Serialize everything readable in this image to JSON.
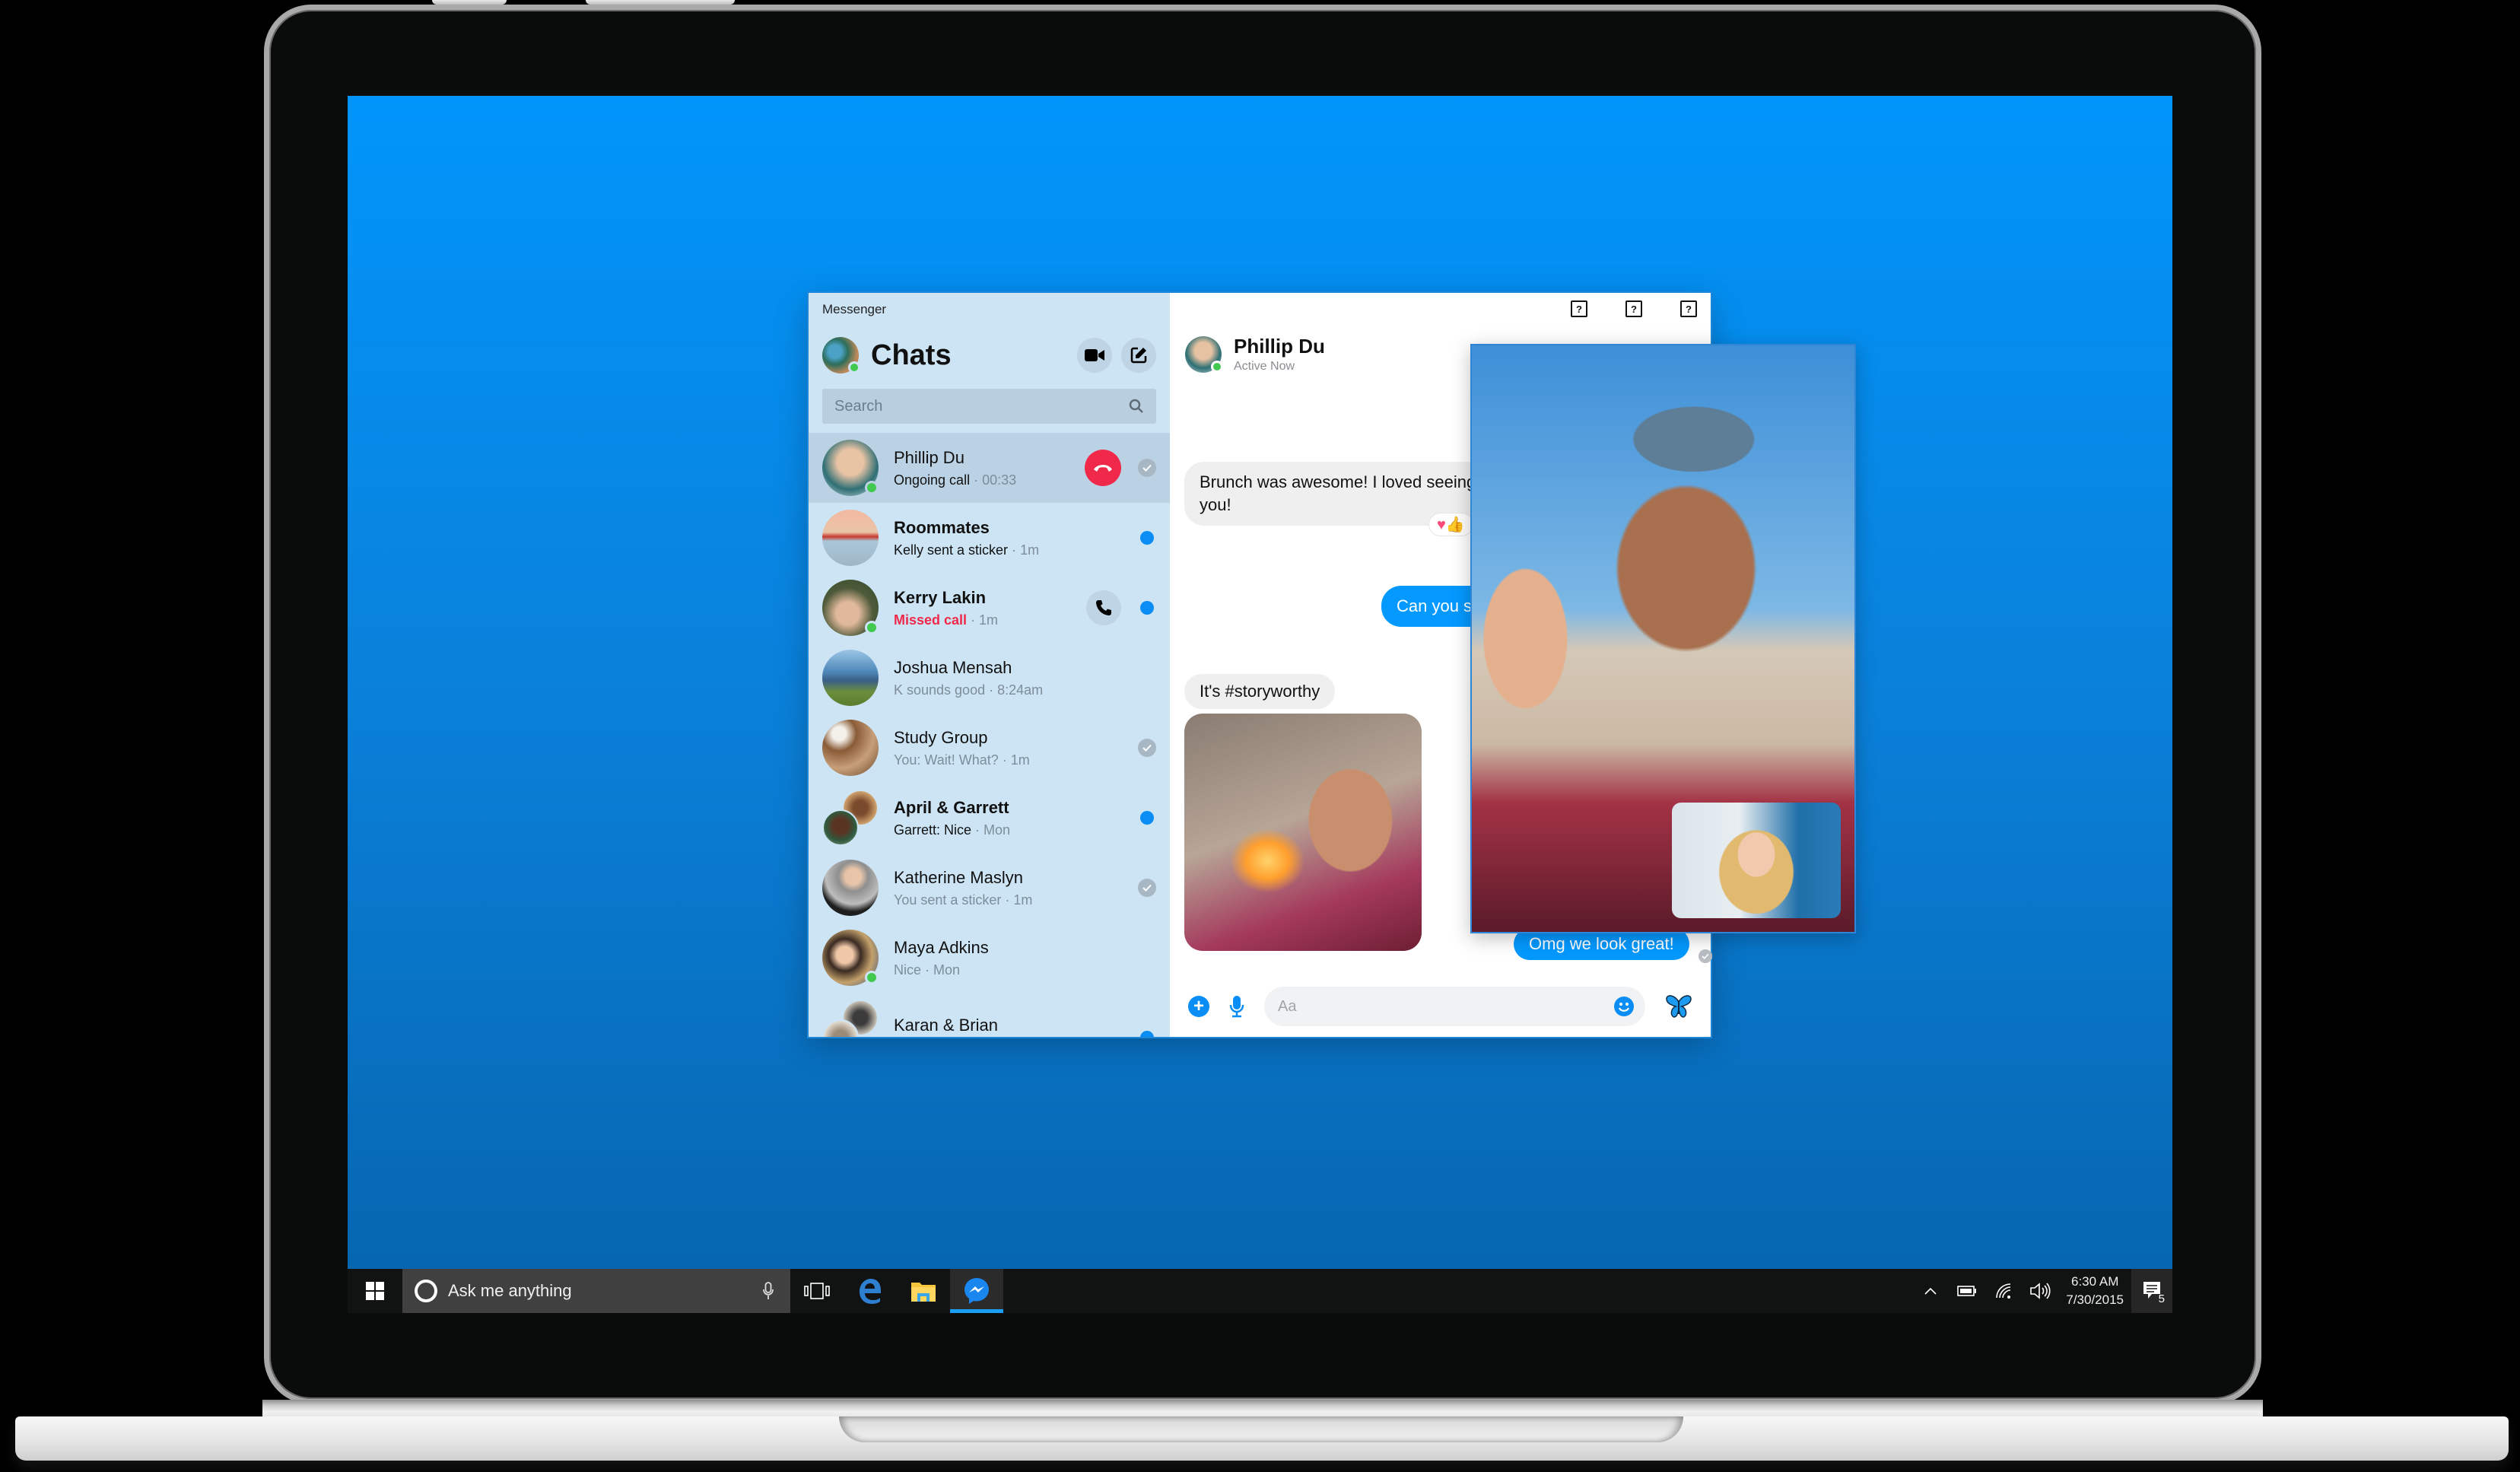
{
  "taskbar": {
    "search_placeholder": "Ask me anything",
    "pinned_apps": [
      "task-view",
      "edge",
      "file-explorer",
      "messenger"
    ],
    "active_app": "messenger",
    "clock_time": "6:30 AM",
    "clock_date": "7/30/2015",
    "notification_count": "5"
  },
  "app": {
    "window_title": "Messenger",
    "accent_color": "#0499ff",
    "sidebar": {
      "title": "Chats",
      "search_placeholder": "Search",
      "chats": [
        {
          "name": "Phillip Du",
          "message": "Ongoing call",
          "time": "00:33",
          "name_bold": false,
          "msg_style": "dark",
          "online": true,
          "action": "end-call",
          "status": "read"
        },
        {
          "name": "Roommates",
          "message": "Kelly sent a sticker",
          "time": "1m",
          "name_bold": true,
          "msg_style": "dark",
          "online": false,
          "action": "",
          "status": "unread"
        },
        {
          "name": "Kerry Lakin",
          "message": "Missed call",
          "time": "1m",
          "name_bold": true,
          "msg_style": "missed",
          "online": true,
          "action": "call",
          "status": "unread"
        },
        {
          "name": "Joshua Mensah",
          "message": "K sounds good",
          "time": "8:24am",
          "name_bold": false,
          "msg_style": "normal",
          "online": false,
          "action": "",
          "status": ""
        },
        {
          "name": "Study Group",
          "message": "You: Wait! What?",
          "time": "1m",
          "name_bold": false,
          "msg_style": "normal",
          "online": false,
          "action": "",
          "status": "read"
        },
        {
          "name": "April & Garrett",
          "message": "Garrett: Nice",
          "time": "Mon",
          "name_bold": true,
          "msg_style": "dark",
          "online": false,
          "action": "",
          "status": "unread"
        },
        {
          "name": "Katherine Maslyn",
          "message": "You sent a sticker",
          "time": "1m",
          "name_bold": false,
          "msg_style": "normal",
          "online": false,
          "action": "",
          "status": "read"
        },
        {
          "name": "Maya Adkins",
          "message": "Nice",
          "time": "Mon",
          "name_bold": false,
          "msg_style": "normal",
          "online": true,
          "action": "",
          "status": ""
        },
        {
          "name": "Karan & Brian",
          "message": "",
          "time": "",
          "name_bold": false,
          "msg_style": "normal",
          "online": false,
          "action": "",
          "status": "unread"
        }
      ]
    },
    "conversation": {
      "contact_name": "Phillip Du",
      "contact_status": "Active Now",
      "window_controls": [
        "?",
        "?",
        "?"
      ],
      "messages": [
        {
          "direction": "in",
          "text": "Brunch was awesome! I loved seeing you!",
          "reactions": "♥👍"
        },
        {
          "direction": "out",
          "text": "Can you s"
        },
        {
          "direction": "in",
          "text": "It's #storyworthy"
        },
        {
          "direction": "in",
          "type": "photo"
        },
        {
          "direction": "out",
          "text": "Omg we look great!"
        }
      ],
      "composer_placeholder": "Aa"
    }
  }
}
